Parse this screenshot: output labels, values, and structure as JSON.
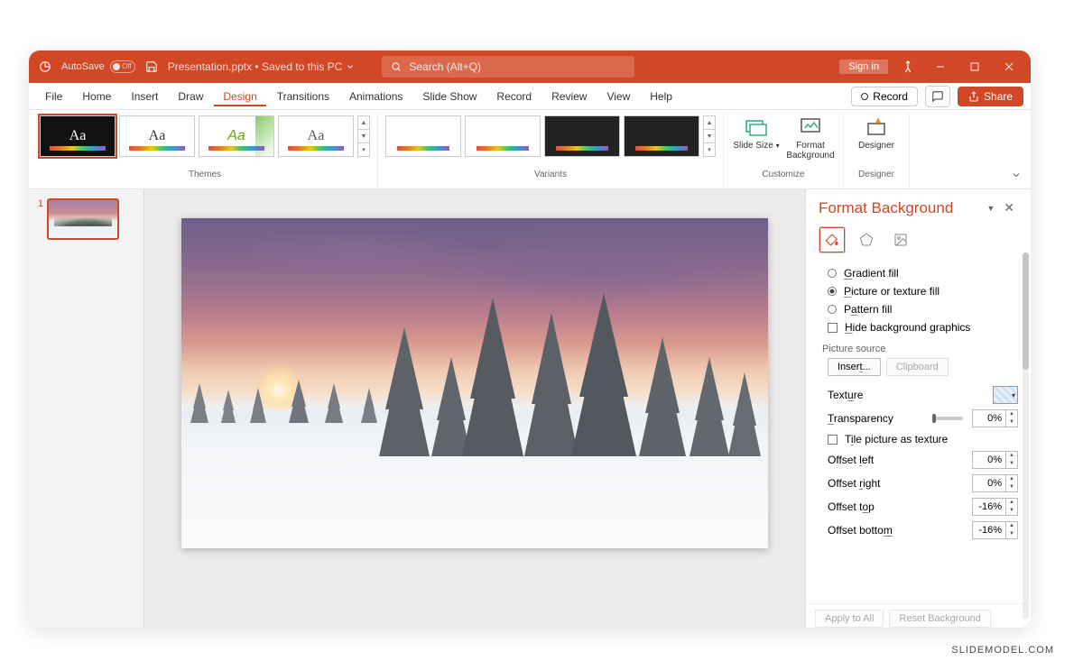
{
  "titlebar": {
    "autosave_label": "AutoSave",
    "autosave_state": "Off",
    "doc_title": "Presentation.pptx • Saved to this PC",
    "search_placeholder": "Search (Alt+Q)",
    "signin_label": "Sign in"
  },
  "menu": {
    "items": [
      "File",
      "Home",
      "Insert",
      "Draw",
      "Design",
      "Transitions",
      "Animations",
      "Slide Show",
      "Record",
      "Review",
      "View",
      "Help"
    ],
    "active_index": 4,
    "record_label": "Record",
    "share_label": "Share"
  },
  "ribbon": {
    "themes_label": "Themes",
    "variants_label": "Variants",
    "customize_label": "Customize",
    "designer_label": "Designer",
    "slide_size_label": "Slide Size",
    "format_background_label": "Format Background",
    "designer_btn_label": "Designer"
  },
  "thumbnails": {
    "slides": [
      {
        "num": "1"
      }
    ]
  },
  "pane": {
    "title": "Format Background",
    "fill_options": {
      "gradient": "Gradient fill",
      "picture": "Picture or texture fill",
      "pattern": "Pattern fill",
      "hide_bg": "Hide background graphics",
      "selected": "picture"
    },
    "picture_source_label": "Picture source",
    "insert_label": "Insert...",
    "clipboard_label": "Clipboard",
    "texture_label": "Texture",
    "transparency_label": "Transparency",
    "transparency_value": "0%",
    "tile_label": "Tile picture as texture",
    "offsets": {
      "left_label": "Offset left",
      "left_value": "0%",
      "right_label": "Offset right",
      "right_value": "0%",
      "top_label": "Offset top",
      "top_value": "-16%",
      "bottom_label": "Offset bottom",
      "bottom_value": "-16%"
    },
    "apply_all": "Apply to All",
    "reset": "Reset Background"
  },
  "watermark": "SLIDEMODEL.COM"
}
